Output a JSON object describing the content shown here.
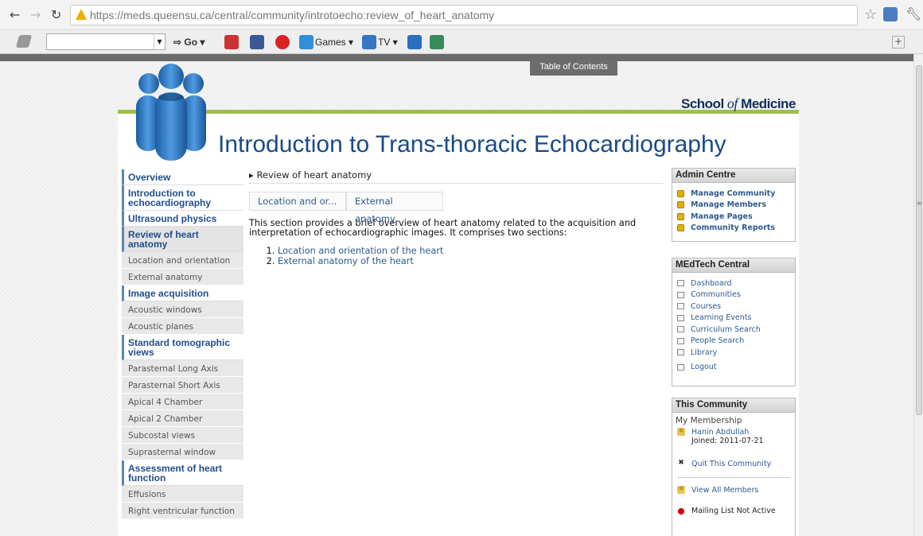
{
  "browser": {
    "url_host": "https://meds.queensu.ca",
    "url_path": "/central/community/introtoecho:review_of_heart_anatomy",
    "toolbar": {
      "go_label": "Go",
      "games_label": "Games",
      "tv_label": "TV"
    }
  },
  "page": {
    "toc_tab": "Table of Contents",
    "school_prefix": "School",
    "school_of": "of",
    "school_suffix": "Medicine",
    "title": "Introduction to Trans-thoracic Echocardiography"
  },
  "nav": {
    "overview": "Overview",
    "intro": "Introduction to echocardiography",
    "ultrasound": "Ultrasound physics",
    "review": "Review of heart anatomy",
    "review_items": [
      "Location and orientation",
      "External anatomy"
    ],
    "acquisition": "Image acquisition",
    "acquisition_items": [
      "Acoustic windows",
      "Acoustic planes"
    ],
    "tomographic": "Standard tomographic views",
    "tomographic_items": [
      "Parasternal Long Axis",
      "Parasternal Short Axis",
      "Apical 4 Chamber",
      "Apical 2 Chamber",
      "Subcostal views",
      "Suprasternal window"
    ],
    "assessment": "Assessment of heart function",
    "assessment_items": [
      "Effusions",
      "Right ventricular function"
    ]
  },
  "content": {
    "breadcrumb": "Review of heart anatomy",
    "tabs": [
      "Location and or...",
      "External anatomy"
    ],
    "intro": "This section provides a brief overview of heart anatomy related to the acquisition and interpretation of echocardiographic images. It comprises two sections:",
    "list": [
      "Location and orientation of the heart",
      "External anatomy of the heart"
    ]
  },
  "admin": {
    "title": "Admin Centre",
    "items": [
      "Manage Community",
      "Manage Members",
      "Manage Pages",
      "Community Reports"
    ]
  },
  "medtech": {
    "title": "MEdTech Central",
    "items": [
      "Dashboard",
      "Communities",
      "Courses",
      "Learning Events",
      "Curriculum Search",
      "People Search",
      "Library"
    ],
    "logout": "Logout"
  },
  "community": {
    "title": "This Community",
    "membership_label": "My Membership",
    "member_name": "Hanin Abdullah",
    "joined": "Joined: 2011-07-21",
    "quit": "Quit This Community",
    "view_all": "View All Members",
    "mailing": "Mailing List Not Active"
  }
}
